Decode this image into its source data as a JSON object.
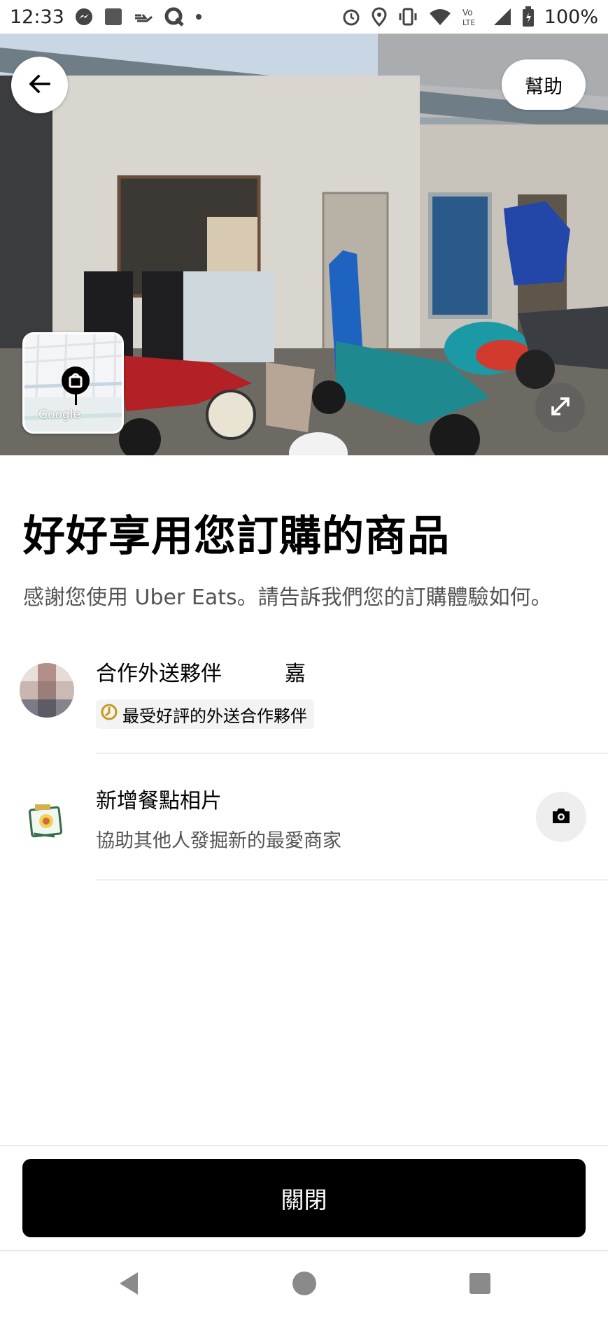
{
  "status_bar": {
    "time": "12:33",
    "battery": "100%",
    "icons_left": [
      "messenger-icon",
      "app-square-icon",
      "gesture-icon",
      "q-app-icon",
      "dot-icon"
    ],
    "icons_right": [
      "alarm-icon",
      "location-icon",
      "vibrate-icon",
      "wifi-icon",
      "volte-icon",
      "signal-icon",
      "battery-icon"
    ]
  },
  "header": {
    "back_icon": "arrow-left-icon",
    "help_label": "幫助"
  },
  "map": {
    "watermark": "Google",
    "pin_icon": "bag-pin-icon"
  },
  "main": {
    "title": "好好享用您訂購的商品",
    "subtitle": "感謝您使用 Uber Eats。請告訴我們您的訂購體驗如何。"
  },
  "courier": {
    "name": "合作外送夥伴　　　嘉",
    "badge_label": "最受好評的外送合作夥伴"
  },
  "add_photo": {
    "title": "新增餐點相片",
    "subtitle": "協助其他人發掘新的最愛商家",
    "action_icon": "camera-icon"
  },
  "footer": {
    "close_label": "關閉"
  },
  "colors": {
    "primary": "#000000",
    "secondary_text": "#545454",
    "badge_bg": "#f3f3f3",
    "badge_icon": "#c59a1c",
    "divider": "#eeeeee"
  }
}
